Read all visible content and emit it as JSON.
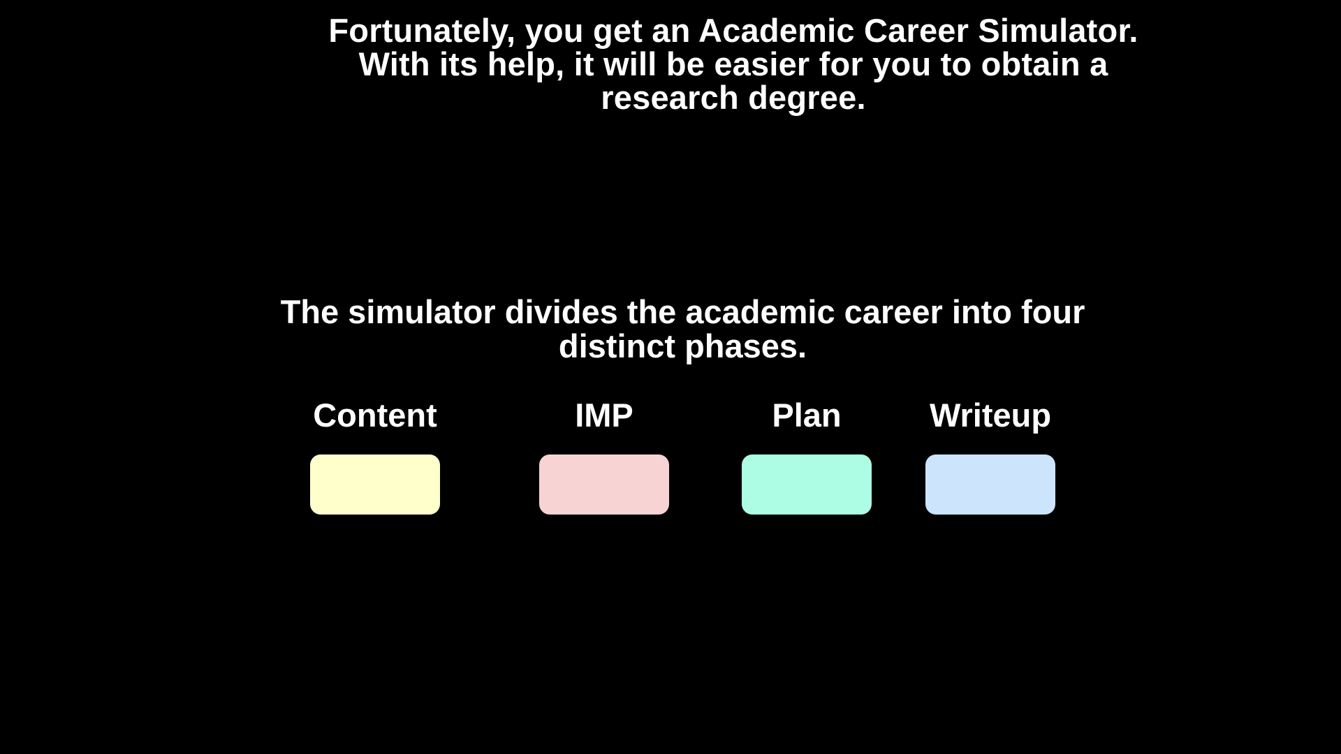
{
  "intro": {
    "text": "Fortunately, you get an Academic Career Simulator. With its help, it will be easier for you to obtain a research degree."
  },
  "phases_heading": "The simulator divides the academic career into four distinct phases.",
  "phases": [
    {
      "label": "Content",
      "color": "#FFFFCC"
    },
    {
      "label": "IMP",
      "color": "#F8D3D3"
    },
    {
      "label": "Plan",
      "color": "#ACFDE4"
    },
    {
      "label": "Writeup",
      "color": "#CCE5FC"
    }
  ]
}
